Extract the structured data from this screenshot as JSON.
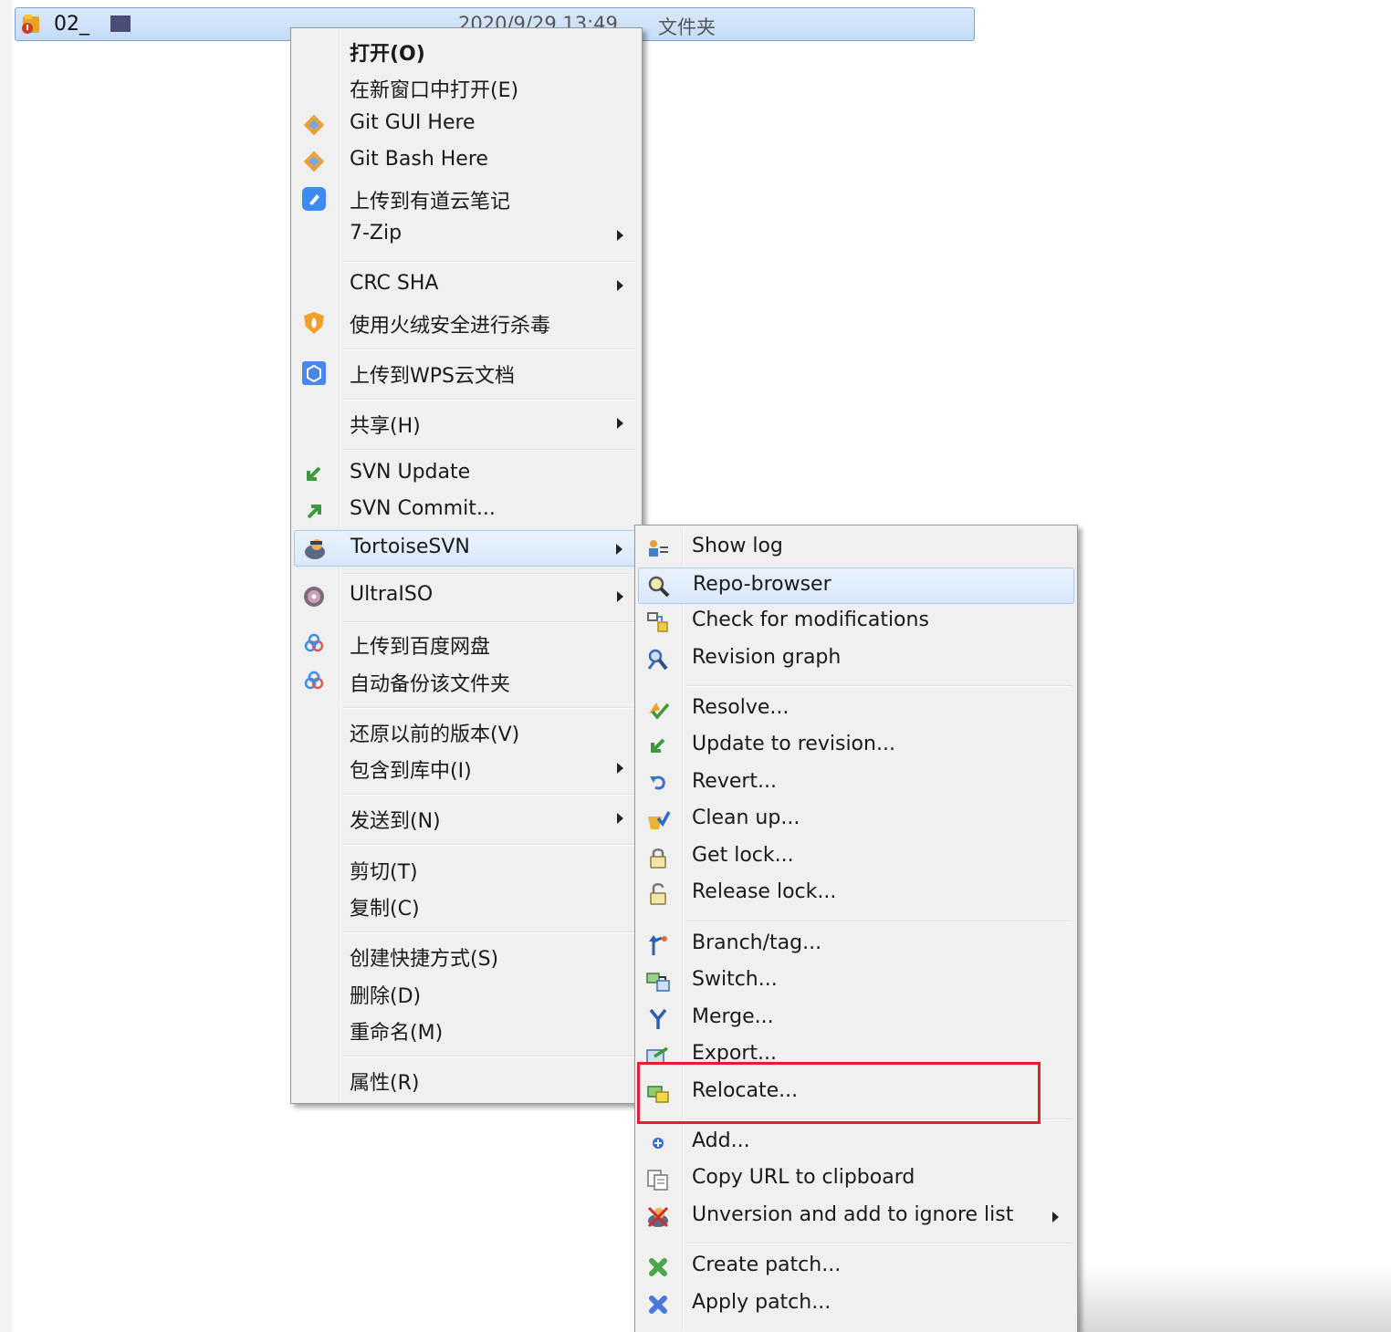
{
  "file_row": {
    "name": "02_",
    "date": "2020/9/29 13:49",
    "type": "文件夹"
  },
  "context_menu": {
    "items": [
      {
        "label": "打开(O)",
        "icon": "none",
        "submenu": false
      },
      {
        "label": "在新窗口中打开(E)",
        "icon": "none",
        "submenu": false
      },
      {
        "label": "Git GUI Here",
        "icon": "git-icon",
        "submenu": false
      },
      {
        "label": "Git Bash Here",
        "icon": "git-icon",
        "submenu": false
      },
      {
        "label": "上传到有道云笔记",
        "icon": "youdao-note-icon",
        "submenu": false
      },
      {
        "label": "7-Zip",
        "icon": "none",
        "submenu": true
      },
      {
        "label": "CRC SHA",
        "icon": "none",
        "submenu": true
      },
      {
        "label": "使用火绒安全进行杀毒",
        "icon": "huorong-shield-icon",
        "submenu": false
      },
      {
        "label": "上传到WPS云文档",
        "icon": "wps-cloud-icon",
        "submenu": false
      },
      {
        "label": "共享(H)",
        "icon": "none",
        "submenu": true
      },
      {
        "label": "SVN Update",
        "icon": "svn-update-icon",
        "submenu": false
      },
      {
        "label": "SVN Commit...",
        "icon": "svn-commit-icon",
        "submenu": false
      },
      {
        "label": "TortoiseSVN",
        "icon": "tortoisesvn-icon",
        "submenu": true,
        "highlighted": true
      },
      {
        "label": "UltraISO",
        "icon": "ultraiso-disc-icon",
        "submenu": true
      },
      {
        "label": "上传到百度网盘",
        "icon": "baidu-netdisk-icon",
        "submenu": false
      },
      {
        "label": "自动备份该文件夹",
        "icon": "baidu-netdisk-icon",
        "submenu": false
      },
      {
        "label": "还原以前的版本(V)",
        "icon": "none",
        "submenu": false
      },
      {
        "label": "包含到库中(I)",
        "icon": "none",
        "submenu": true
      },
      {
        "label": "发送到(N)",
        "icon": "none",
        "submenu": true
      },
      {
        "label": "剪切(T)",
        "icon": "none",
        "submenu": false
      },
      {
        "label": "复制(C)",
        "icon": "none",
        "submenu": false
      },
      {
        "label": "创建快捷方式(S)",
        "icon": "none",
        "submenu": false
      },
      {
        "label": "删除(D)",
        "icon": "none",
        "submenu": false
      },
      {
        "label": "重命名(M)",
        "icon": "none",
        "submenu": false
      },
      {
        "label": "属性(R)",
        "icon": "none",
        "submenu": false
      }
    ]
  },
  "tortoise_submenu": {
    "items": [
      {
        "label": "Show log",
        "icon": "show-log-icon"
      },
      {
        "label": "Repo-browser",
        "icon": "repo-browser-icon",
        "highlighted": true
      },
      {
        "label": "Check for modifications",
        "icon": "check-modifications-icon"
      },
      {
        "label": "Revision graph",
        "icon": "revision-graph-icon"
      },
      {
        "label": "Resolve...",
        "icon": "resolve-icon"
      },
      {
        "label": "Update to revision...",
        "icon": "update-revision-icon"
      },
      {
        "label": "Revert...",
        "icon": "revert-icon"
      },
      {
        "label": "Clean up...",
        "icon": "cleanup-icon"
      },
      {
        "label": "Get lock...",
        "icon": "lock-icon"
      },
      {
        "label": "Release lock...",
        "icon": "unlock-icon"
      },
      {
        "label": "Branch/tag...",
        "icon": "branch-tag-icon"
      },
      {
        "label": "Switch...",
        "icon": "switch-icon"
      },
      {
        "label": "Merge...",
        "icon": "merge-icon"
      },
      {
        "label": "Export...",
        "icon": "export-icon"
      },
      {
        "label": "Relocate...",
        "icon": "relocate-icon",
        "annotated": true
      },
      {
        "label": "Add...",
        "icon": "add-icon"
      },
      {
        "label": "Copy URL to clipboard",
        "icon": "copy-url-icon"
      },
      {
        "label": "Unversion and add to ignore list",
        "icon": "unversion-ignore-icon",
        "submenu": true
      },
      {
        "label": "Create patch...",
        "icon": "create-patch-icon"
      },
      {
        "label": "Apply patch...",
        "icon": "apply-patch-icon"
      }
    ]
  },
  "annotation": {
    "color": "#e0202c"
  }
}
